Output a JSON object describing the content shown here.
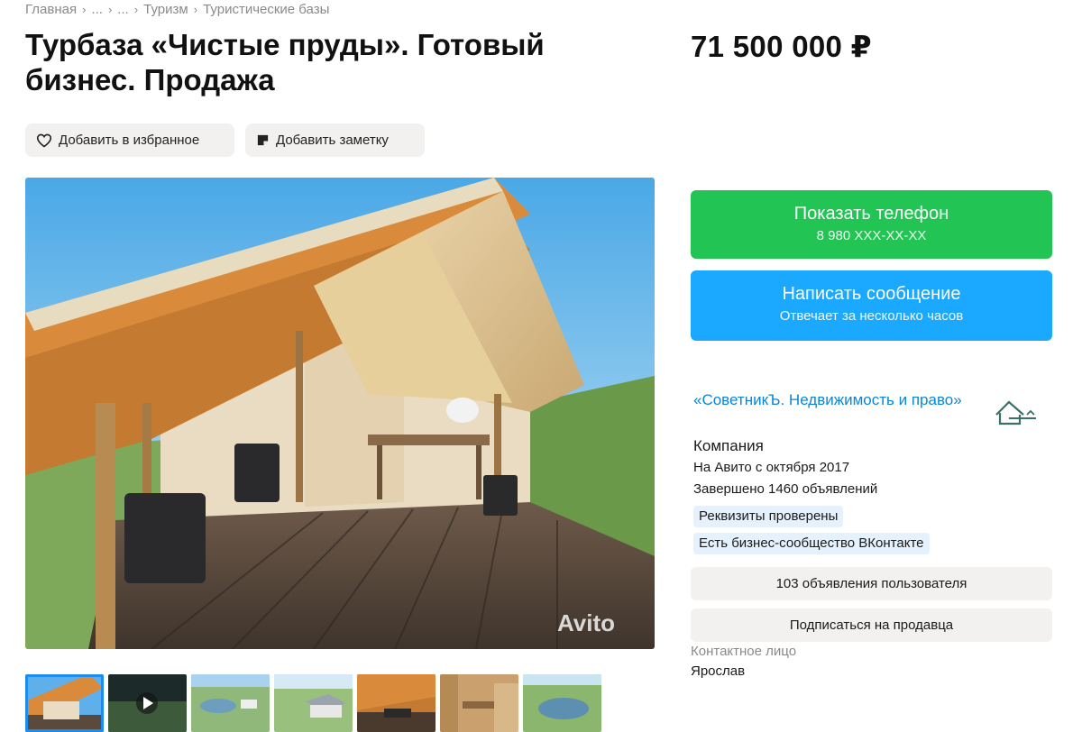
{
  "breadcrumb": {
    "items": [
      "Главная",
      "...",
      "...",
      "Туризм",
      "Туристические базы"
    ]
  },
  "title": "Турбаза «Чистые пруды». Готовый бизнес. Продажа",
  "price": "71 500 000 ₽",
  "actions": {
    "favorite_label": "Добавить в избранное",
    "note_label": "Добавить заметку"
  },
  "gallery": {
    "watermark": "Avito",
    "thumbnail_count": 7,
    "active_index": 0
  },
  "contact_buttons": {
    "phone_label": "Показать телефон",
    "phone_masked": "8 980 XXX-XX-XX",
    "message_label": "Написать сообщение",
    "message_sub": "Отвечает за несколько часов"
  },
  "seller": {
    "name": "«СоветникЪ. Недвижимость и право»",
    "type": "Компания",
    "since": "На Авито с октября 2017",
    "completed": "Завершено 1460 объявлений",
    "badges": [
      "Реквизиты проверены",
      "Есть бизнес-сообщество ВКонтакте"
    ],
    "listings_button": "103 объявления пользователя",
    "subscribe_button": "Подписаться на продавца",
    "contact_label": "Контактное лицо",
    "contact_name": "Ярослав"
  },
  "colors": {
    "green": "#22c553",
    "blue": "#1ba8ff",
    "link": "#0a85d8",
    "badge_bg": "#e5f2fd",
    "chip_bg": "#f2f1f0"
  }
}
